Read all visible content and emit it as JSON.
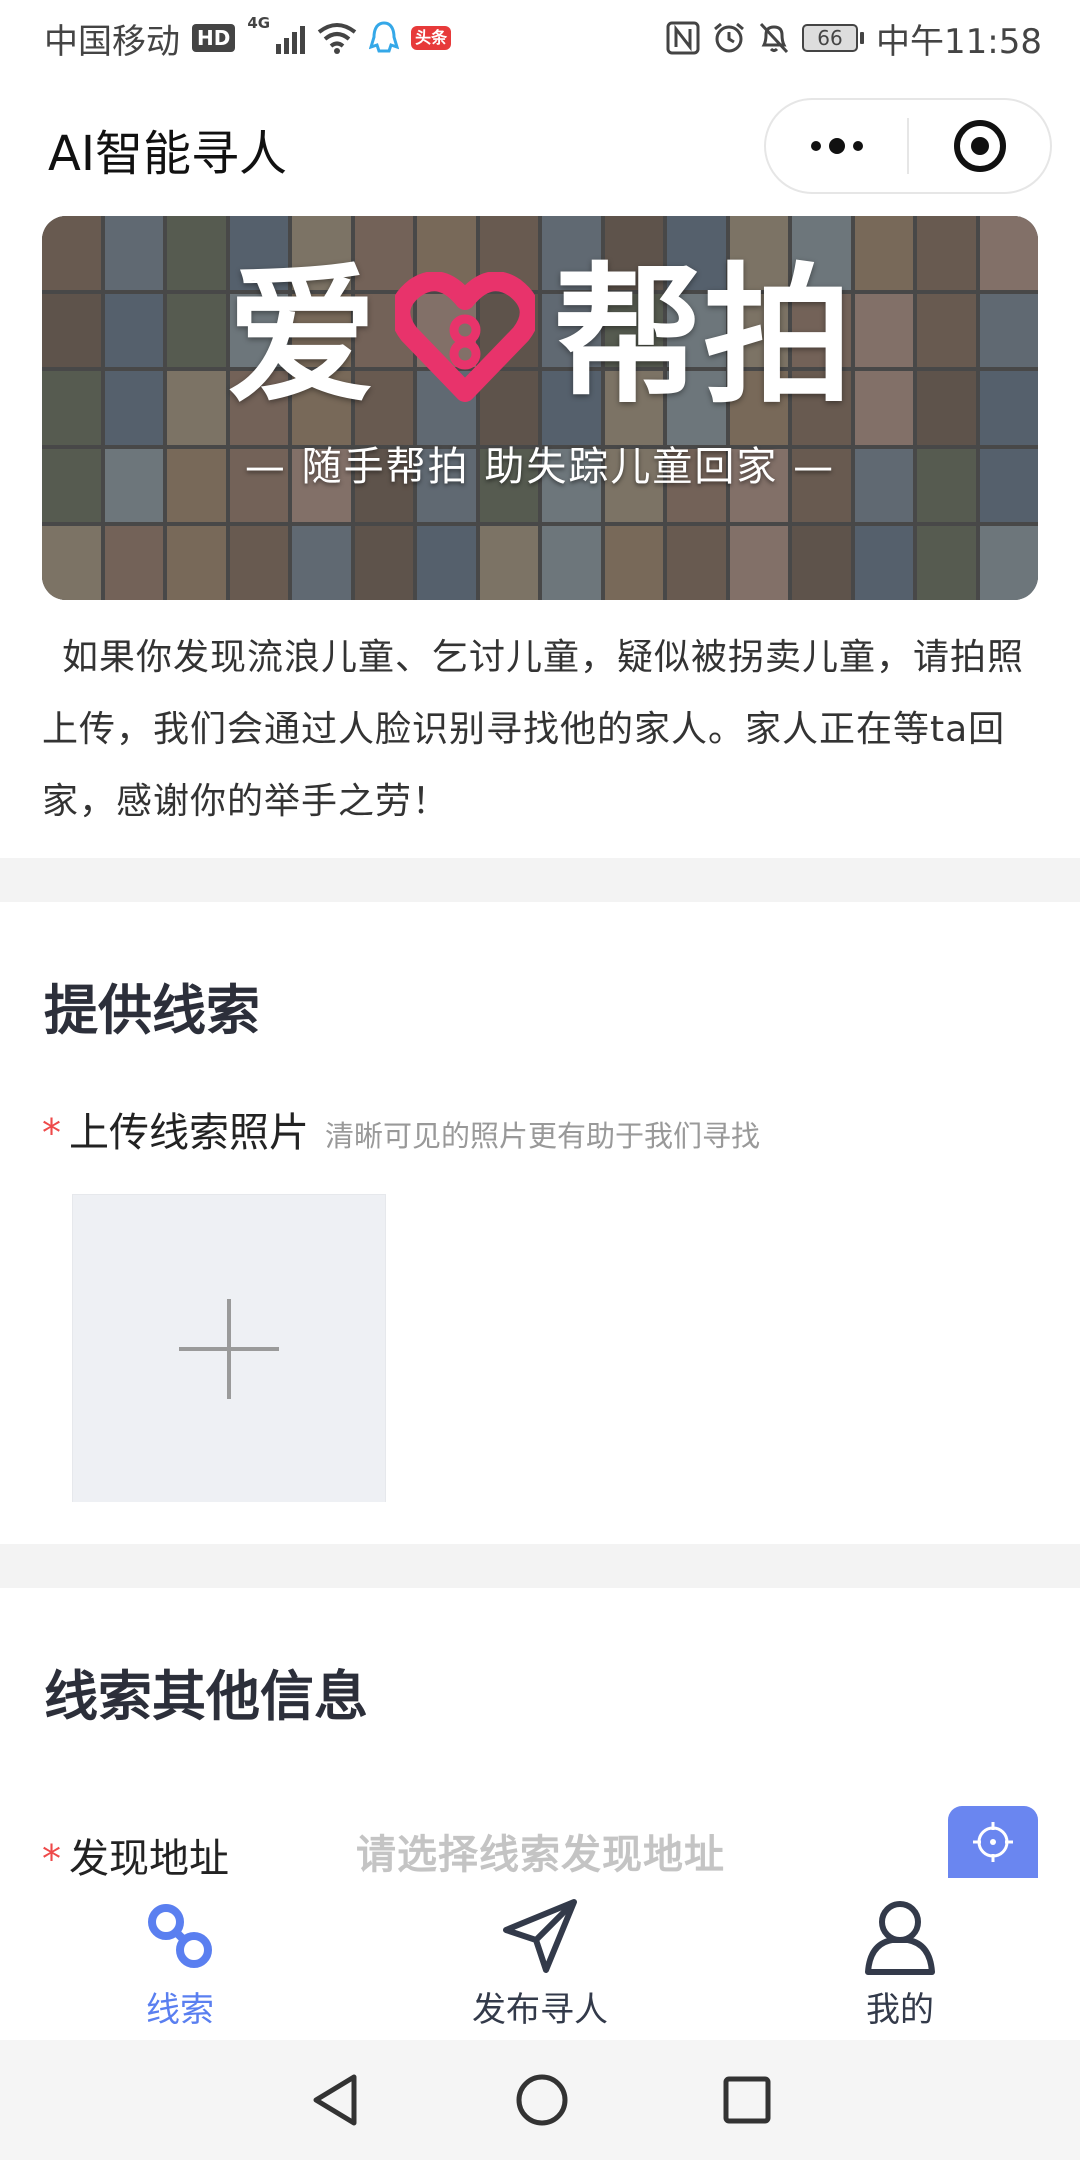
{
  "status_bar": {
    "carrier": "中国移动",
    "hd_badge": "HD",
    "network": "4G",
    "app_badge": "头条",
    "battery": "66",
    "time": "中午11:58"
  },
  "nav": {
    "title": "AI智能寻人"
  },
  "banner": {
    "logo_left": "爱",
    "logo_right": "帮拍",
    "subtitle": "— 随手帮拍 助失踪儿童回家 —",
    "accent_color": "#e8336b"
  },
  "intro_text": "如果你发现流浪儿童、乞讨儿童，疑似被拐卖儿童，请拍照上传，我们会通过人脸识别寻找他的家人。家人正在等ta回家，感谢你的举手之劳！",
  "clue_section": {
    "title": "提供线索",
    "required_mark": "*",
    "upload_label": "上传线索照片",
    "upload_hint": "清晰可见的照片更有助于我们寻找"
  },
  "other_section": {
    "title": "线索其他信息",
    "required_mark": "*",
    "address_label": "发现地址",
    "address_placeholder": "请选择线索发现地址"
  },
  "tabs": [
    {
      "label": "线索",
      "icon": "clue-chain-icon",
      "active": true
    },
    {
      "label": "发布寻人",
      "icon": "send-arrow-icon",
      "active": false
    },
    {
      "label": "我的",
      "icon": "person-icon",
      "active": false
    }
  ],
  "colors": {
    "primary": "#5a7ff0",
    "tab_inactive": "#333a4a",
    "required": "#ee4a4a"
  }
}
